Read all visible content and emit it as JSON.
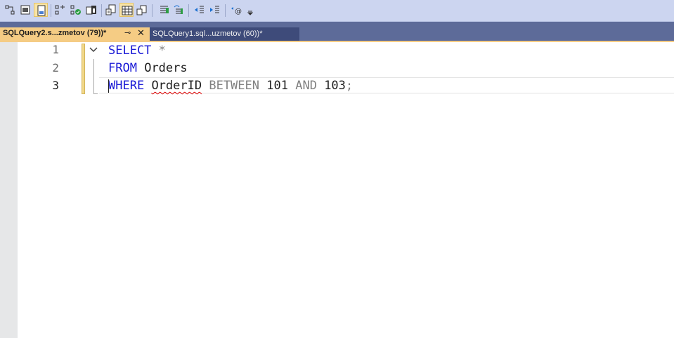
{
  "toolbar": {
    "buttons": [
      {
        "icon": "query-options-icon"
      },
      {
        "icon": "results-to-text-icon"
      },
      {
        "icon": "results-to-grid-icon",
        "active": true
      },
      {
        "icon": "display-estimated-plan-icon"
      },
      {
        "icon": "include-actual-plan-icon"
      },
      {
        "icon": "include-client-statistics-icon"
      },
      {
        "icon": "results-to-file-icon"
      },
      {
        "icon": "results-grid-icon",
        "active": true
      },
      {
        "icon": "results-file-icon"
      },
      {
        "icon": "comment-lines-icon"
      },
      {
        "icon": "uncomment-lines-icon"
      },
      {
        "icon": "decrease-indent-icon"
      },
      {
        "icon": "increase-indent-icon"
      },
      {
        "icon": "specify-template-values-icon"
      },
      {
        "icon": "toolbar-overflow-icon"
      }
    ]
  },
  "tabs": {
    "active": {
      "label": "SQLQuery2.s...zmetov (79))*"
    },
    "inactive": {
      "label": "SQLQuery1.sql...uzmetov (60))*"
    }
  },
  "editor": {
    "line_numbers": [
      "1",
      "2",
      "3"
    ],
    "current_line": 3,
    "lines": [
      {
        "tokens": [
          {
            "text": "SELECT",
            "kind": "keyword"
          },
          {
            "text": " ",
            "kind": "space"
          },
          {
            "text": "*",
            "kind": "operator"
          }
        ]
      },
      {
        "tokens": [
          {
            "text": "FROM",
            "kind": "keyword"
          },
          {
            "text": " ",
            "kind": "space"
          },
          {
            "text": "Orders",
            "kind": "identifier"
          }
        ]
      },
      {
        "tokens": [
          {
            "text": "WHERE",
            "kind": "keyword"
          },
          {
            "text": " ",
            "kind": "space"
          },
          {
            "text": "OrderID",
            "kind": "identifier-error"
          },
          {
            "text": " ",
            "kind": "space"
          },
          {
            "text": "BETWEEN",
            "kind": "operator"
          },
          {
            "text": " ",
            "kind": "space"
          },
          {
            "text": "101",
            "kind": "number"
          },
          {
            "text": " ",
            "kind": "space"
          },
          {
            "text": "AND",
            "kind": "operator"
          },
          {
            "text": " ",
            "kind": "space"
          },
          {
            "text": "103",
            "kind": "number"
          },
          {
            "text": ";",
            "kind": "operator"
          }
        ]
      }
    ]
  },
  "colors": {
    "keyword": "#1a1ad6",
    "operator": "#808080",
    "active_tab": "#f5cc84",
    "tab_strip": "#5d6b99",
    "toolbar": "#ccd5f0"
  }
}
